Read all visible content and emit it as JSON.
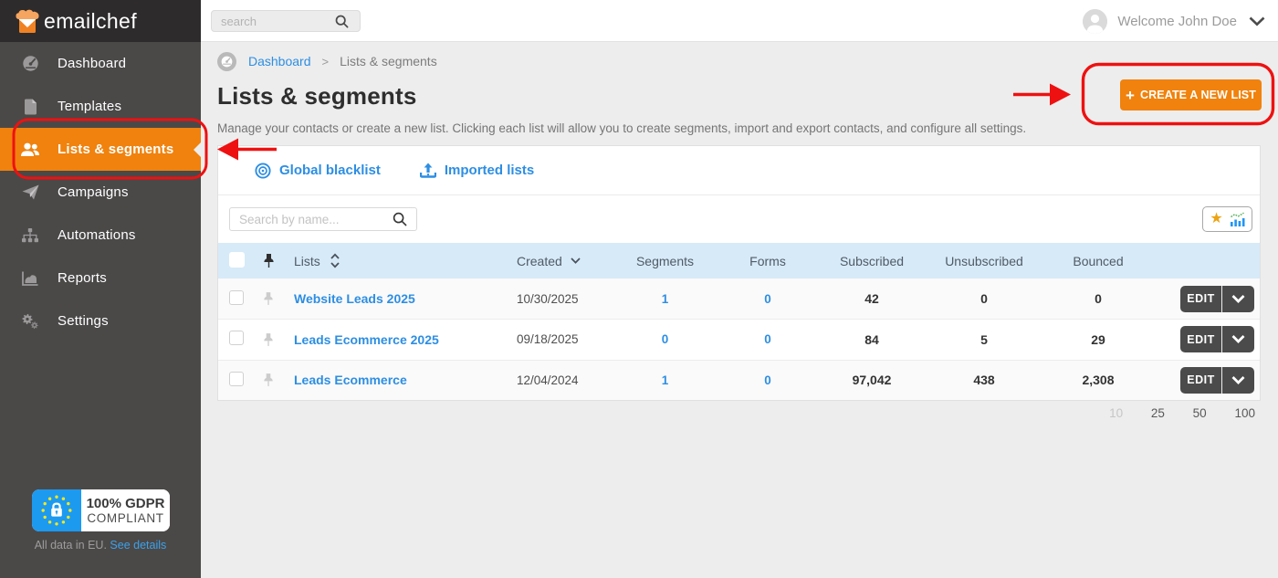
{
  "brand": {
    "name": "emailchef"
  },
  "topbar": {
    "search_placeholder": "search",
    "welcome": "Welcome John Doe"
  },
  "sidebar": {
    "items": [
      {
        "label": "Dashboard",
        "icon": "gauge-icon",
        "active": false
      },
      {
        "label": "Templates",
        "icon": "file-icon",
        "active": false
      },
      {
        "label": "Lists & segments",
        "icon": "users-icon",
        "active": true
      },
      {
        "label": "Campaigns",
        "icon": "paper-plane-icon",
        "active": false
      },
      {
        "label": "Automations",
        "icon": "sitemap-icon",
        "active": false
      },
      {
        "label": "Reports",
        "icon": "chart-icon",
        "active": false
      },
      {
        "label": "Settings",
        "icon": "gears-icon",
        "active": false
      }
    ],
    "gdpr": {
      "line1": "100% GDPR",
      "line2": "COMPLIANT",
      "caption": "All data in EU.",
      "link": "See details"
    }
  },
  "breadcrumb": {
    "home": "Dashboard",
    "separator": ">",
    "current": "Lists & segments"
  },
  "page": {
    "title": "Lists & segments",
    "subtitle": "Manage your contacts or create a new list. Clicking each list will allow you to create segments, import and export contacts, and configure all settings.",
    "create_button": {
      "icon": "+",
      "label": "CREATE A NEW LIST"
    }
  },
  "panel": {
    "links": [
      {
        "label": "Global blacklist",
        "icon": "target-icon"
      },
      {
        "label": "Imported lists",
        "icon": "upload-icon"
      }
    ],
    "search_placeholder": "Search by name...",
    "table": {
      "headers": {
        "lists": "Lists",
        "created": "Created",
        "segments": "Segments",
        "forms": "Forms",
        "subscribed": "Subscribed",
        "unsubscribed": "Unsubscribed",
        "bounced": "Bounced"
      },
      "edit_label": "EDIT",
      "rows": [
        {
          "name": "Website Leads 2025",
          "created": "10/30/2025",
          "segments": "1",
          "forms": "0",
          "subscribed": "42",
          "unsubscribed": "0",
          "bounced": "0"
        },
        {
          "name": "Leads Ecommerce 2025",
          "created": "09/18/2025",
          "segments": "0",
          "forms": "0",
          "subscribed": "84",
          "unsubscribed": "5",
          "bounced": "29"
        },
        {
          "name": "Leads Ecommerce",
          "created": "12/04/2024",
          "segments": "1",
          "forms": "0",
          "subscribed": "97,042",
          "unsubscribed": "438",
          "bounced": "2,308"
        }
      ]
    },
    "pagination": [
      "10",
      "25",
      "50",
      "100"
    ]
  },
  "colors": {
    "accent_orange": "#f0820d",
    "sidebar_bg": "#4b4848",
    "logo_band_bg": "#2d2b2c",
    "link_blue": "#2d8ee3",
    "table_header_blue": "#d7eaf8",
    "annotation_red": "#ee1111",
    "gdpr_blue": "#1c9af0",
    "star_yellow": "#eca414",
    "edit_btn_gray": "#4b4b4b"
  }
}
